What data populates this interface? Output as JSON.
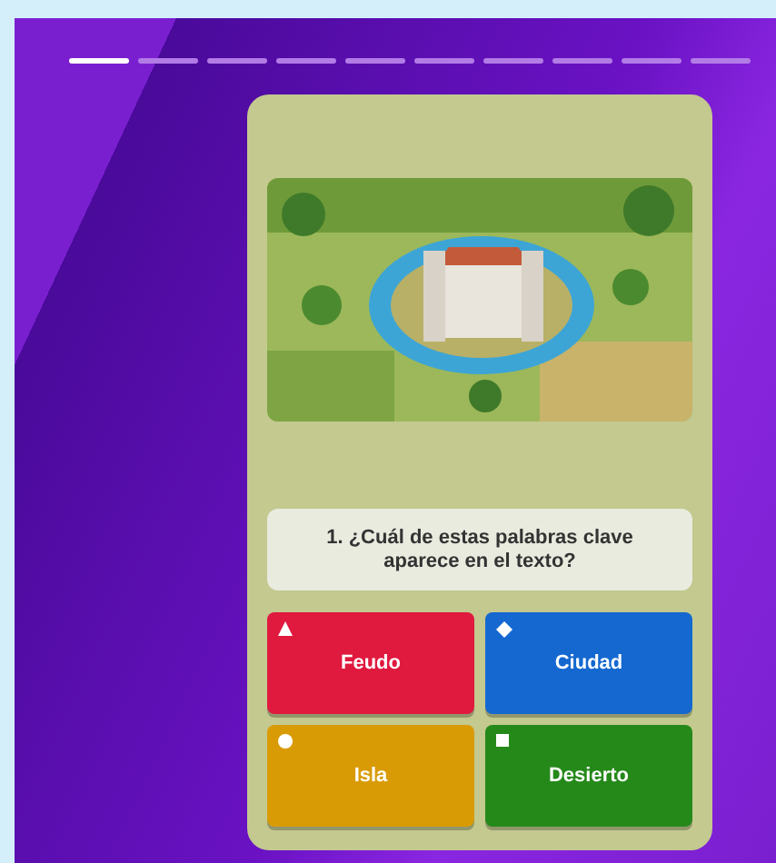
{
  "progress": [
    {
      "done": true
    },
    {
      "done": false
    },
    {
      "done": false
    },
    {
      "done": false
    },
    {
      "done": false
    },
    {
      "done": false
    },
    {
      "done": false
    },
    {
      "done": false
    },
    {
      "done": false
    },
    {
      "done": false
    }
  ],
  "question": {
    "number": "1.",
    "text": "¿Cuál de estas palabras clave aparece en el texto?"
  },
  "answers": [
    {
      "kind": "triangle",
      "label": "Feudo",
      "color": "#e0193f"
    },
    {
      "kind": "diamond",
      "label": "Ciudad",
      "color": "#1468d0"
    },
    {
      "kind": "circle",
      "label": "Isla",
      "color": "#d99b05"
    },
    {
      "kind": "square",
      "label": "Desierto",
      "color": "#25891a"
    }
  ]
}
